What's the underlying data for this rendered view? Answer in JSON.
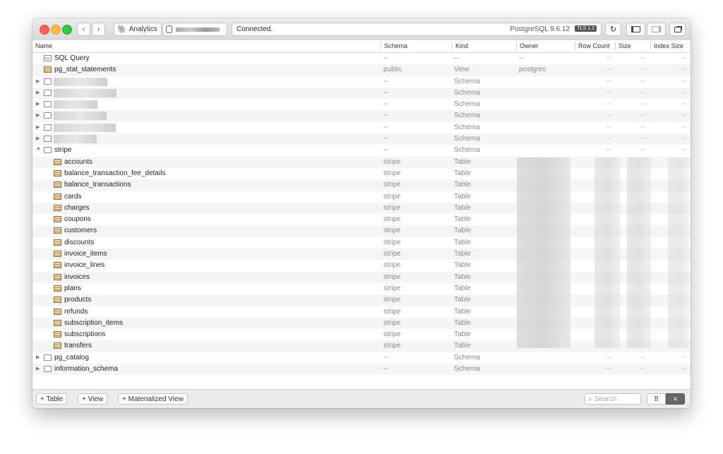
{
  "toolbar": {
    "connection_name": "Analytics",
    "status": "Connected.",
    "server_version": "PostgreSQL 9.6.12",
    "tls_badge": "TLS 1.2"
  },
  "columns": [
    "Name",
    "Schema",
    "Kind",
    "Owner",
    "Row Count",
    "Size",
    "Index Size"
  ],
  "rows": [
    {
      "name": "SQL Query",
      "icon": "sql-icon",
      "schema": "--",
      "kind": "--",
      "owner": "--",
      "dashes": true
    },
    {
      "name": "pg_stat_statements",
      "icon": "table-icon",
      "schema": "public",
      "kind": "View",
      "owner": "postgres",
      "dashes": true
    },
    {
      "name": "",
      "icon": "folder-icon",
      "expand": "collapsed",
      "schema": "--",
      "kind": "Schema",
      "owner": "",
      "dashes": true,
      "redacted": true
    },
    {
      "name": "",
      "icon": "folder-icon",
      "expand": "collapsed",
      "schema": "--",
      "kind": "Schema",
      "owner": "",
      "dashes": true,
      "redacted": true
    },
    {
      "name": "",
      "icon": "folder-icon",
      "expand": "collapsed",
      "schema": "--",
      "kind": "Schema",
      "owner": "",
      "dashes": true,
      "redacted": true
    },
    {
      "name": "",
      "icon": "folder-icon",
      "expand": "collapsed",
      "schema": "--",
      "kind": "Schema",
      "owner": "",
      "dashes": true,
      "redacted": true
    },
    {
      "name": "",
      "icon": "folder-icon",
      "expand": "collapsed",
      "schema": "--",
      "kind": "Schema",
      "owner": "",
      "dashes": true,
      "redacted": true
    },
    {
      "name": "",
      "icon": "folder-icon",
      "expand": "collapsed",
      "schema": "--",
      "kind": "Schema",
      "owner": "",
      "dashes": true,
      "redacted": true
    },
    {
      "name": "stripe",
      "icon": "folder-icon",
      "expand": "expanded",
      "schema": "--",
      "kind": "Schema",
      "owner": "",
      "dashes": true
    },
    {
      "name": "accounts",
      "icon": "table-icon",
      "child": true,
      "schema": "stripe",
      "kind": "Table"
    },
    {
      "name": "balance_transaction_fee_details",
      "icon": "table-icon",
      "child": true,
      "schema": "stripe",
      "kind": "Table"
    },
    {
      "name": "balance_transactions",
      "icon": "table-icon",
      "child": true,
      "schema": "stripe",
      "kind": "Table"
    },
    {
      "name": "cards",
      "icon": "table-icon",
      "child": true,
      "schema": "stripe",
      "kind": "Table"
    },
    {
      "name": "charges",
      "icon": "table-icon",
      "child": true,
      "schema": "stripe",
      "kind": "Table"
    },
    {
      "name": "coupons",
      "icon": "table-icon",
      "child": true,
      "schema": "stripe",
      "kind": "Table"
    },
    {
      "name": "customers",
      "icon": "table-icon",
      "child": true,
      "schema": "stripe",
      "kind": "Table"
    },
    {
      "name": "discounts",
      "icon": "table-icon",
      "child": true,
      "schema": "stripe",
      "kind": "Table"
    },
    {
      "name": "invoice_items",
      "icon": "table-icon",
      "child": true,
      "schema": "stripe",
      "kind": "Table"
    },
    {
      "name": "invoice_lines",
      "icon": "table-icon",
      "child": true,
      "schema": "stripe",
      "kind": "Table"
    },
    {
      "name": "invoices",
      "icon": "table-icon",
      "child": true,
      "schema": "stripe",
      "kind": "Table"
    },
    {
      "name": "plans",
      "icon": "table-icon",
      "child": true,
      "schema": "stripe",
      "kind": "Table"
    },
    {
      "name": "products",
      "icon": "table-icon",
      "child": true,
      "schema": "stripe",
      "kind": "Table"
    },
    {
      "name": "refunds",
      "icon": "table-icon",
      "child": true,
      "schema": "stripe",
      "kind": "Table"
    },
    {
      "name": "subscription_items",
      "icon": "table-icon",
      "child": true,
      "schema": "stripe",
      "kind": "Table"
    },
    {
      "name": "subscriptions",
      "icon": "table-icon",
      "child": true,
      "schema": "stripe",
      "kind": "Table"
    },
    {
      "name": "transfers",
      "icon": "table-icon",
      "child": true,
      "schema": "stripe",
      "kind": "Table"
    },
    {
      "name": "pg_catalog",
      "icon": "folder-icon",
      "expand": "collapsed",
      "schema": "--",
      "kind": "Schema",
      "owner": "",
      "dashes": true
    },
    {
      "name": "information_schema",
      "icon": "folder-icon",
      "expand": "collapsed",
      "schema": "--",
      "kind": "Schema",
      "owner": "",
      "dashes": true
    }
  ],
  "bottom": {
    "add_table": "+ Table",
    "add_view": "+ View",
    "add_materialized_view": "+ Materialized View",
    "search_placeholder": "Search"
  }
}
